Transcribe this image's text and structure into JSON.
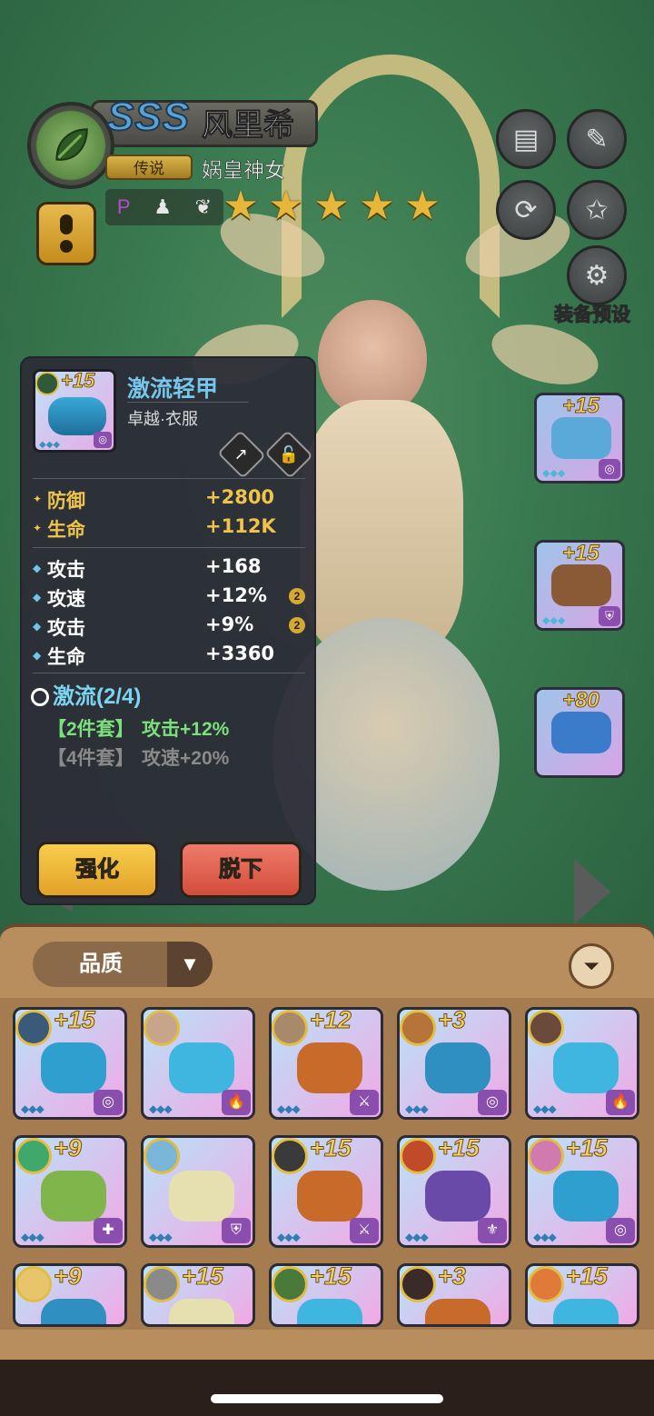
{
  "hero": {
    "grade": "SSS",
    "name": "风里希",
    "rarity": "传说",
    "title": "娲皇神女",
    "stars": 5,
    "trait_icons": [
      "P",
      "♟",
      "❦"
    ]
  },
  "side_menu": {
    "preset_label": "装备预设"
  },
  "equipped_slots": [
    {
      "plus": "+15",
      "color": "#5aa9d8"
    },
    {
      "plus": "+15",
      "color": "#8a5a36"
    },
    {
      "plus": "+80",
      "color": "#3a7cc9"
    }
  ],
  "detail": {
    "plus": "+15",
    "name": "激流轻甲",
    "type": "卓越·衣服",
    "main_stats": [
      {
        "label": "防御",
        "value": "+2800"
      },
      {
        "label": "生命",
        "value": "+112K"
      }
    ],
    "sub_stats": [
      {
        "label": "攻击",
        "value": "+168",
        "badge": ""
      },
      {
        "label": "攻速",
        "value": "+12%",
        "badge": "2"
      },
      {
        "label": "攻击",
        "value": "+9%",
        "badge": "2"
      },
      {
        "label": "生命",
        "value": "+3360",
        "badge": ""
      }
    ],
    "set_title": "激流(2/4)",
    "set_bonuses": [
      {
        "tag": "【2件套】",
        "effect": "攻击+12%",
        "active": true
      },
      {
        "tag": "【4件套】",
        "effect": "攻速+20%",
        "active": false
      }
    ],
    "enhance_label": "强化",
    "unequip_label": "脱下"
  },
  "inventory": {
    "sort_label": "品质",
    "items": [
      {
        "plus": "+15",
        "art": "#2f9fd0",
        "av": "#3b5a7a"
      },
      {
        "plus": "",
        "art": "#3fb6e0",
        "av": "#c7a58a"
      },
      {
        "plus": "+12",
        "art": "#c76a2a",
        "av": "#a88a6a"
      },
      {
        "plus": "+3",
        "art": "#2f8fc0",
        "av": "#b6743a"
      },
      {
        "plus": "",
        "art": "#3fb6e0",
        "av": "#6a4a3a"
      },
      {
        "plus": "+9",
        "art": "#7fb54a",
        "av": "#3fa86a"
      },
      {
        "plus": "",
        "art": "#e6e0b0",
        "av": "#7ab6d8"
      },
      {
        "plus": "+15",
        "art": "#c76a2a",
        "av": "#3a3a3a"
      },
      {
        "plus": "+15",
        "art": "#6a4aa8",
        "av": "#c04a2a"
      },
      {
        "plus": "+15",
        "art": "#2f9fd0",
        "av": "#d07ab0"
      },
      {
        "plus": "+9",
        "art": "#2f8fc0",
        "av": "#e8c46a"
      },
      {
        "plus": "+15",
        "art": "#e6e0b0",
        "av": "#8a8a8a"
      },
      {
        "plus": "+15",
        "art": "#3fb6e0",
        "av": "#4a7a3a"
      },
      {
        "plus": "+3",
        "art": "#c76a2a",
        "av": "#3a2a2a"
      },
      {
        "plus": "+15",
        "art": "#3fb6e0",
        "av": "#e07a3a"
      }
    ]
  }
}
